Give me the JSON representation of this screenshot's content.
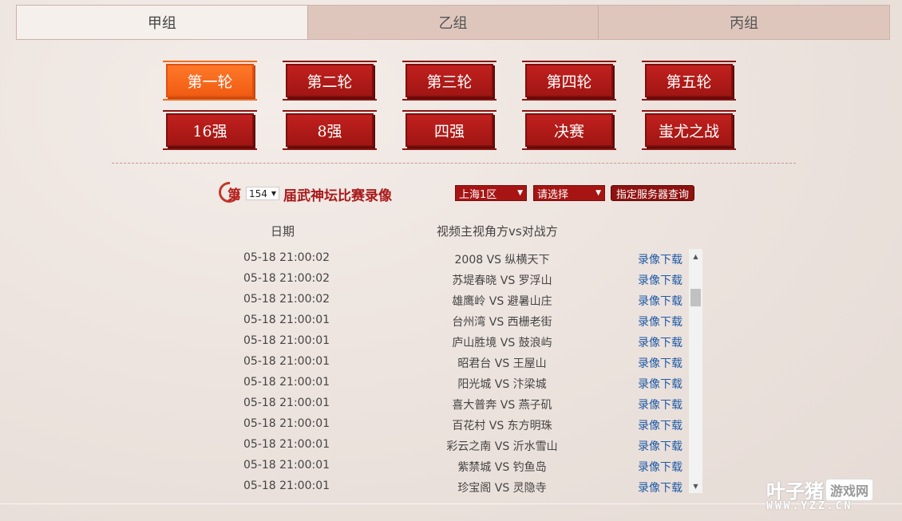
{
  "groups": [
    {
      "label": "甲组",
      "active": true
    },
    {
      "label": "乙组",
      "active": false
    },
    {
      "label": "丙组",
      "active": false
    }
  ],
  "rounds": [
    {
      "label": "第一轮",
      "active": true
    },
    {
      "label": "第二轮",
      "active": false
    },
    {
      "label": "第三轮",
      "active": false
    },
    {
      "label": "第四轮",
      "active": false
    },
    {
      "label": "第五轮",
      "active": false
    },
    {
      "label": "16强",
      "active": false
    },
    {
      "label": "8强",
      "active": false
    },
    {
      "label": "四强",
      "active": false
    },
    {
      "label": "决赛",
      "active": false
    },
    {
      "label": "蚩尤之战",
      "active": false
    }
  ],
  "title": {
    "prefix": "第",
    "session": "154",
    "suffix": "届武神坛比赛录像"
  },
  "server_select": {
    "value": "上海1区"
  },
  "sub_select": {
    "value": "请选择"
  },
  "query_button": "指定服务器查询",
  "columns": {
    "date": "日期",
    "match": "视频主视角方vs对战方"
  },
  "download_label": "录像下载",
  "rows": [
    {
      "date": "05-18 21:00:02",
      "match": "2008 VS 纵横天下"
    },
    {
      "date": "05-18 21:00:02",
      "match": "苏堤春晓 VS 罗浮山"
    },
    {
      "date": "05-18 21:00:02",
      "match": "雄鹰岭 VS 避暑山庄"
    },
    {
      "date": "05-18 21:00:01",
      "match": "台州湾 VS 西栅老街"
    },
    {
      "date": "05-18 21:00:01",
      "match": "庐山胜境 VS 鼓浪屿"
    },
    {
      "date": "05-18 21:00:01",
      "match": "昭君台 VS 王屋山"
    },
    {
      "date": "05-18 21:00:01",
      "match": "阳光城 VS 汴梁城"
    },
    {
      "date": "05-18 21:00:01",
      "match": "喜大普奔 VS 燕子矶"
    },
    {
      "date": "05-18 21:00:01",
      "match": "百花村 VS 东方明珠"
    },
    {
      "date": "05-18 21:00:01",
      "match": "彩云之南 VS 沂水雪山"
    },
    {
      "date": "05-18 21:00:01",
      "match": "紫禁城 VS 钓鱼岛"
    },
    {
      "date": "05-18 21:00:01",
      "match": "珍宝阁 VS 灵隐寺"
    }
  ],
  "watermark": {
    "brand": "叶子猪",
    "badge": "游戏网",
    "url": "WWW.YZZ.CN"
  }
}
